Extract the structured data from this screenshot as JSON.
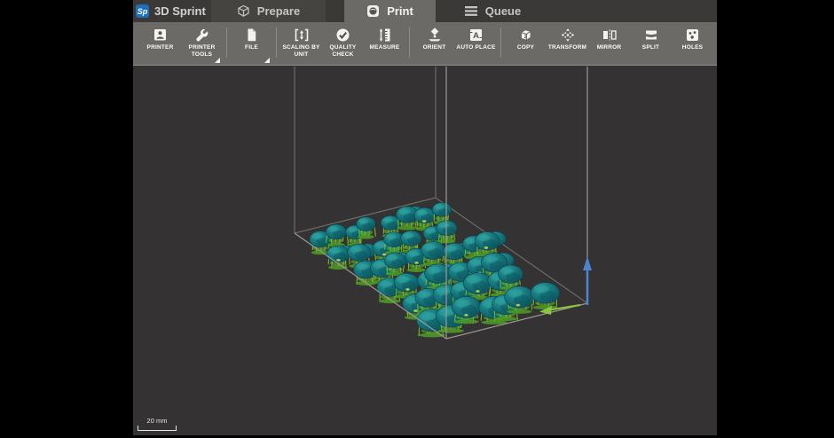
{
  "header": {
    "logo_text": "Sp",
    "app_title": "3D Sprint",
    "tabs": [
      {
        "id": "prepare",
        "label": "Prepare",
        "icon": "cube-icon",
        "active": false
      },
      {
        "id": "print",
        "label": "Print",
        "icon": "sphere-icon",
        "active": true
      },
      {
        "id": "queue",
        "label": "Queue",
        "icon": "menu-icon",
        "active": false
      }
    ]
  },
  "toolbar": {
    "groups": [
      {
        "buttons": [
          {
            "label": "PRINTER",
            "icon": "printer-icon",
            "has_dropdown": false
          },
          {
            "label": "PRINTER TOOLS",
            "icon": "wrench-icon",
            "has_dropdown": true
          }
        ]
      },
      {
        "buttons": [
          {
            "label": "FILE",
            "icon": "file-icon",
            "has_dropdown": true
          }
        ]
      },
      {
        "buttons": [
          {
            "label": "SCALING BY UNIT",
            "icon": "scaling-icon",
            "has_dropdown": false
          },
          {
            "label": "QUALITY CHECK",
            "icon": "quality-check-icon",
            "has_dropdown": false
          },
          {
            "label": "MEASURE",
            "icon": "measure-icon",
            "has_dropdown": false
          }
        ]
      },
      {
        "buttons": [
          {
            "label": "ORIENT",
            "icon": "orient-icon",
            "has_dropdown": false
          },
          {
            "label": "AUTO PLACE",
            "icon": "auto-place-icon",
            "has_dropdown": false
          }
        ]
      },
      {
        "buttons": [
          {
            "label": "COPY",
            "icon": "copy-icon",
            "has_dropdown": false
          },
          {
            "label": "TRANSFORM",
            "icon": "transform-icon",
            "has_dropdown": false
          },
          {
            "label": "MIRROR",
            "icon": "mirror-icon",
            "has_dropdown": false
          },
          {
            "label": "SPLIT",
            "icon": "split-icon",
            "has_dropdown": false
          },
          {
            "label": "HOLES",
            "icon": "holes-icon",
            "has_dropdown": false
          }
        ]
      }
    ]
  },
  "viewport": {
    "scale_bar_label": "20 mm",
    "scene": {
      "background": "#343232",
      "wireframe_color": "#9c9992",
      "wireframe_back_color": "#777570",
      "model_color": "#177a80",
      "model_dark": "#0c525c",
      "model_light": "#2ea19e",
      "support_color": "#6fc12e",
      "support_base_color": "#4f9e23",
      "accent_yellow": "#c9d94e",
      "z_axis_color": "#4d84cc",
      "pan_arrow_color": "#8cc63e",
      "model_rows": 6,
      "models_per_row": 8
    }
  }
}
